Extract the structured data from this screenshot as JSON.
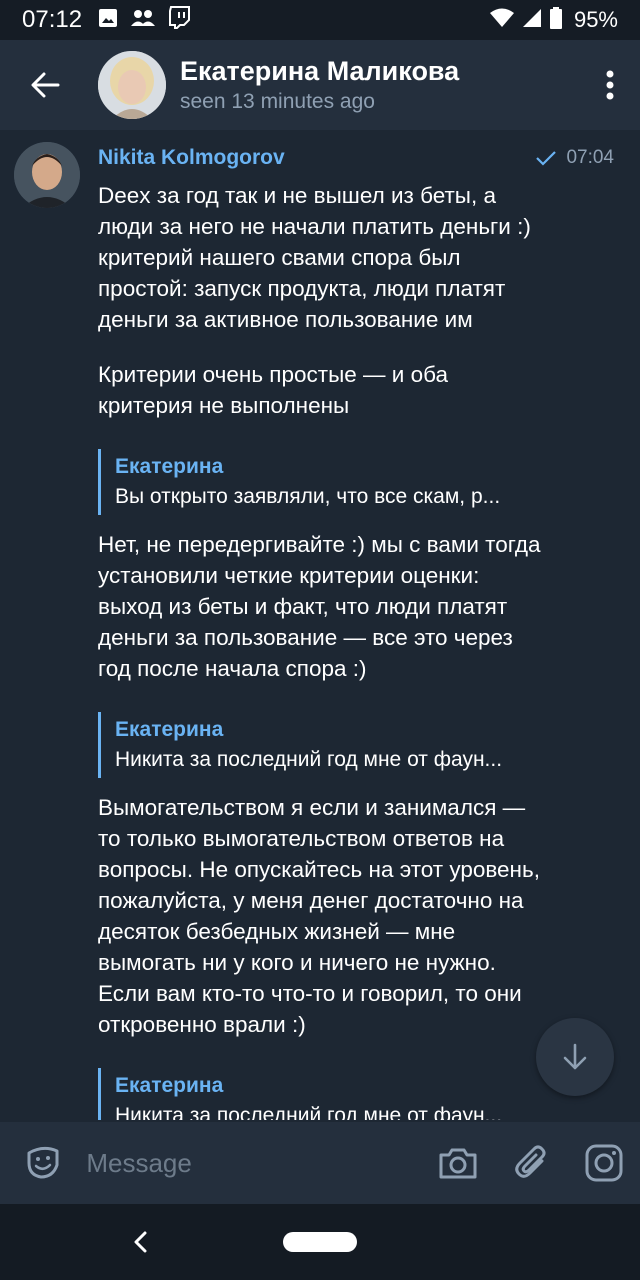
{
  "status_bar": {
    "time": "07:12",
    "battery": "95%",
    "left_icons": [
      "image-icon",
      "people-icon",
      "twitch-icon"
    ],
    "right_icons": [
      "wifi-icon",
      "signal-icon",
      "battery-icon"
    ]
  },
  "header": {
    "name": "Екатерина Маликова",
    "status": "seen 13 minutes ago",
    "icons": [
      "back-arrow-icon",
      "more-vert-icon"
    ]
  },
  "message": {
    "sender": "Nikita Kolmogorov",
    "time": "07:04",
    "read_icon": "check-icon",
    "paragraph_1": "Deex за год так и не вышел из беты, а\nлюди за него не начали платить деньги :)\nкритерий нашего свами спора был\nпростой: запуск продукта, люди платят\nденьги за активное пользование им",
    "paragraph_2": "Критерии очень простые — и оба\nкритерия не выполнены",
    "quote_1": {
      "name": "Екатерина",
      "text": "Вы открыто заявляли, что все скам, р..."
    },
    "paragraph_3": "Нет, не передергивайте :) мы с вами тогда\nустановили четкие критерии оценки:\nвыход из беты и факт, что люди платят\nденьги за пользование — все это через\nгод после начала спора :)",
    "quote_2": {
      "name": "Екатерина",
      "text": "Никита за последний год мне от фаун..."
    },
    "paragraph_4": "Вымогательством я если и занимался —\nто только вымогательством ответов на\nвопросы. Не опускайтесь на этот уровень,\nпожалуйста, у меня денег достаточно на\nдесяток безбедных жизней — мне\nвымогать ни у кого и ничего не нужно.\nЕсли вам кто-то что-то и говорил, то они\nоткровенно врали :)",
    "quote_3": {
      "name": "Екатерина",
      "text": "Никита за последний год мне от фаун..."
    }
  },
  "input": {
    "placeholder": "Message",
    "icons": [
      "sticker-icon",
      "camera-icon",
      "attach-icon",
      "instagram-icon"
    ]
  },
  "colors": {
    "background": "#1d2733",
    "header": "#242f3d",
    "accent": "#6ab3f3",
    "secondary_text": "#8fa0b3"
  }
}
